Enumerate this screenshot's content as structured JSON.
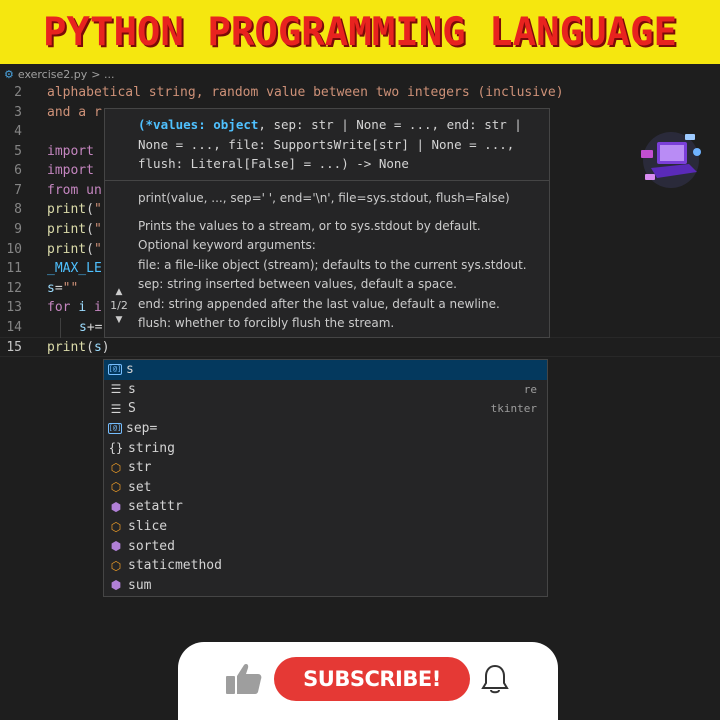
{
  "banner": {
    "title": "PYTHON PROGRAMMING LANGUAGE"
  },
  "breadcrumb": {
    "file": "exercise2.py",
    "trail": "> ..."
  },
  "code_lines": [
    {
      "num": "2",
      "text": "alphabetical string, random value between two integers (inclusive)"
    },
    {
      "num": "3",
      "text": "and a r"
    },
    {
      "num": "4",
      "text": ""
    },
    {
      "num": "5",
      "text": "import"
    },
    {
      "num": "6",
      "text": "import"
    },
    {
      "num": "7",
      "text": "from un"
    },
    {
      "num": "8",
      "text": "print(\""
    },
    {
      "num": "9",
      "text": "print(\""
    },
    {
      "num": "10",
      "text": "print(\""
    },
    {
      "num": "11",
      "text": "_MAX_LE"
    },
    {
      "num": "12",
      "text": "s=\"\""
    },
    {
      "num": "13",
      "text": "for i i"
    },
    {
      "num": "14",
      "text": "s+="
    },
    {
      "num": "15",
      "text": "print(s)"
    }
  ],
  "hover": {
    "signature_hl": "(*values: object",
    "signature_rest": ", sep: str | None = ..., end: str | None = ..., file: SupportsWrite[str] | None = ..., flush: Literal[False] = ...) -> None",
    "sig_plain": "print(value, ..., sep=' ', end='\\n', file=sys.stdout, flush=False)",
    "doc_lines": [
      "Prints the values to a stream, or to sys.stdout by default.",
      "Optional keyword arguments:",
      "file: a file-like object (stream); defaults to the current sys.stdout.",
      "sep: string inserted between values, default a space.",
      "end: string appended after the last value, default a newline.",
      "flush: whether to forcibly flush the stream."
    ],
    "pager": "1/2"
  },
  "suggestions": [
    {
      "icon": "variable-icon",
      "label": "s",
      "detail": ""
    },
    {
      "icon": "module-icon",
      "label": "s",
      "detail": "re"
    },
    {
      "icon": "module-icon",
      "label": "S",
      "detail": "tkinter"
    },
    {
      "icon": "variable-icon",
      "label": "sep=",
      "detail": ""
    },
    {
      "icon": "snippet-icon",
      "label": "string",
      "detail": ""
    },
    {
      "icon": "class-icon",
      "label": "str",
      "detail": ""
    },
    {
      "icon": "class-icon",
      "label": "set",
      "detail": ""
    },
    {
      "icon": "function-icon",
      "label": "setattr",
      "detail": ""
    },
    {
      "icon": "class-icon",
      "label": "slice",
      "detail": ""
    },
    {
      "icon": "function-icon",
      "label": "sorted",
      "detail": ""
    },
    {
      "icon": "class-icon",
      "label": "staticmethod",
      "detail": ""
    },
    {
      "icon": "function-icon",
      "label": "sum",
      "detail": ""
    }
  ],
  "subscribe": {
    "label": "SUBSCRIBE!"
  },
  "colors": {
    "banner_bg": "#f5e70f",
    "banner_text": "#e8231f",
    "subscribe_bg": "#e53935",
    "selection": "#04395e"
  }
}
